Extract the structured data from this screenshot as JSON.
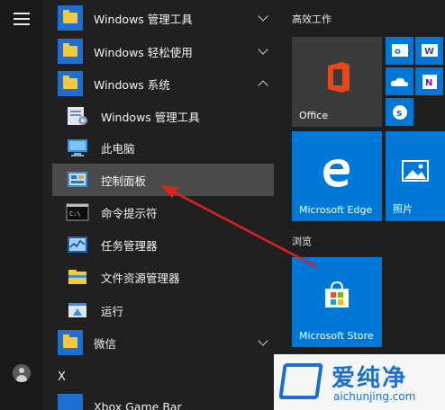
{
  "app_list": {
    "groups": [
      {
        "label": "Windows 管理工具",
        "expanded": false
      },
      {
        "label": "Windows 轻松使用",
        "expanded": false
      },
      {
        "label": "Windows 系统",
        "expanded": true
      }
    ],
    "children": [
      {
        "label": "Windows 管理工具",
        "icon": "admin-tools-icon"
      },
      {
        "label": "此电脑",
        "icon": "this-pc-icon"
      },
      {
        "label": "控制面板",
        "icon": "control-panel-icon",
        "selected": true
      },
      {
        "label": "命令提示符",
        "icon": "cmd-icon"
      },
      {
        "label": "任务管理器",
        "icon": "task-manager-icon"
      },
      {
        "label": "文件资源管理器",
        "icon": "file-explorer-icon"
      },
      {
        "label": "运行",
        "icon": "run-icon"
      }
    ],
    "wechat": {
      "label": "微信"
    },
    "letter_x": "X",
    "xbox": {
      "label": "Xbox Game Bar"
    }
  },
  "tiles": {
    "section_productivity": "高效工作",
    "section_browse": "浏览",
    "office": "Office",
    "edge": "Microsoft Edge",
    "photos": "照片",
    "store": "Microsoft Store"
  },
  "watermark": {
    "title": "爱纯净",
    "url": "aichunjing.com"
  },
  "colors": {
    "accent": "#0078d7",
    "arrow": "#e02020"
  }
}
